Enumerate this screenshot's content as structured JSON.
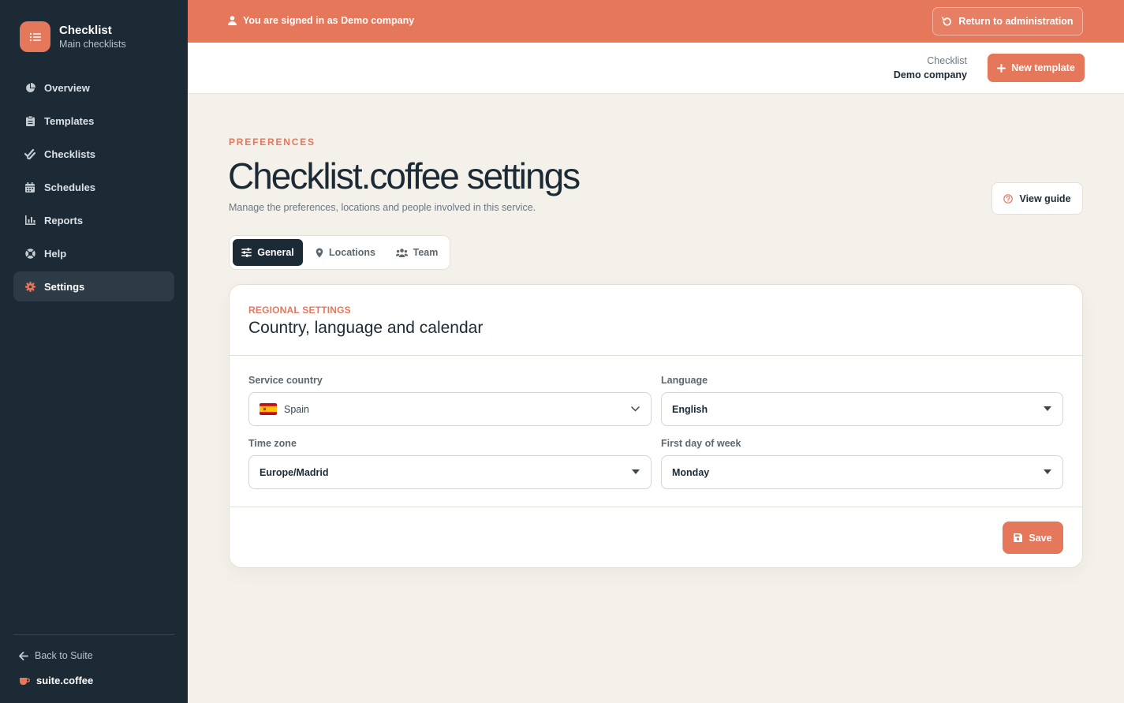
{
  "colors": {
    "accent": "#e5775b",
    "sidebar": "#1c2a35",
    "background": "#f4f1eb"
  },
  "brand": {
    "title": "Checklist",
    "subtitle": "Main checklists",
    "icon": "list-icon"
  },
  "sidebar": {
    "items": [
      {
        "label": "Overview",
        "icon": "pie-chart-icon",
        "active": false
      },
      {
        "label": "Templates",
        "icon": "clipboard-icon",
        "active": false
      },
      {
        "label": "Checklists",
        "icon": "double-check-icon",
        "active": false
      },
      {
        "label": "Schedules",
        "icon": "calendar-icon",
        "active": false
      },
      {
        "label": "Reports",
        "icon": "bar-chart-icon",
        "active": false
      },
      {
        "label": "Help",
        "icon": "life-ring-icon",
        "active": false
      },
      {
        "label": "Settings",
        "icon": "gear-icon",
        "active": true
      }
    ],
    "back_label": "Back to Suite",
    "suite_label": "suite.coffee"
  },
  "banner": {
    "text": "You are signed in as Demo company",
    "return_label": "Return to administration"
  },
  "header": {
    "context_top": "Checklist",
    "context_bottom": "Demo company",
    "new_template_label": "New template"
  },
  "main": {
    "eyebrow": "PREFERENCES",
    "title": "Checklist.coffee settings",
    "subtitle": "Manage the preferences, locations and people involved in this service.",
    "guide_label": "View guide",
    "tabs": [
      {
        "label": "General",
        "icon": "sliders-icon",
        "active": true
      },
      {
        "label": "Locations",
        "icon": "map-pin-icon",
        "active": false
      },
      {
        "label": "Team",
        "icon": "users-icon",
        "active": false
      }
    ]
  },
  "card": {
    "eyebrow": "REGIONAL SETTINGS",
    "title": "Country, language and calendar",
    "fields": {
      "country": {
        "label": "Service country",
        "value": "Spain"
      },
      "language": {
        "label": "Language",
        "value": "English"
      },
      "timezone": {
        "label": "Time zone",
        "value": "Europe/Madrid"
      },
      "first_day": {
        "label": "First day of week",
        "value": "Monday"
      }
    },
    "save_label": "Save"
  }
}
